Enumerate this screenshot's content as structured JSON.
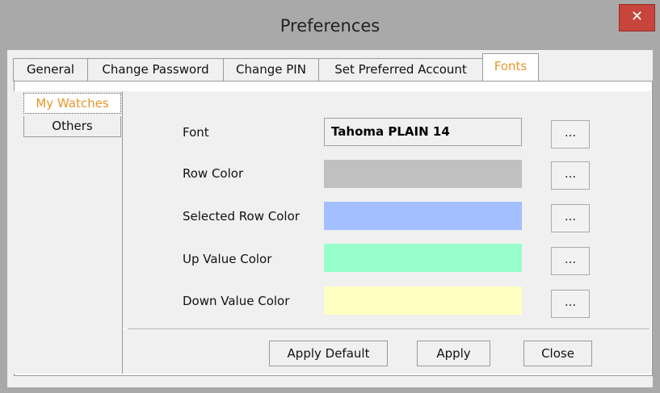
{
  "window": {
    "title": "Preferences",
    "close_glyph": "✕"
  },
  "tabs": [
    {
      "label": "General",
      "active": false
    },
    {
      "label": "Change Password",
      "active": false
    },
    {
      "label": "Change PIN",
      "active": false
    },
    {
      "label": "Set Preferred Account",
      "active": false
    },
    {
      "label": "Fonts",
      "active": true
    }
  ],
  "sidetabs": [
    {
      "label": "My Watches",
      "active": true
    },
    {
      "label": "Others",
      "active": false
    }
  ],
  "settings": {
    "font": {
      "label": "Font",
      "value": "Tahoma PLAIN 14",
      "button": "..."
    },
    "row_color": {
      "label": "Row Color",
      "color": "#c0c0c0",
      "button": "..."
    },
    "selected_row_color": {
      "label": "Selected Row Color",
      "color": "#a3bfff",
      "button": "..."
    },
    "up_value_color": {
      "label": "Up Value Color",
      "color": "#98ffcc",
      "button": "..."
    },
    "down_value_color": {
      "label": "Down Value Color",
      "color": "#ffffc2",
      "button": "..."
    }
  },
  "buttons": {
    "apply_default": "Apply Default",
    "apply": "Apply",
    "close": "Close"
  },
  "colors": {
    "accent": "#e8962b",
    "title_bar": "#a9a9a9",
    "close_button": "#c7453b"
  }
}
